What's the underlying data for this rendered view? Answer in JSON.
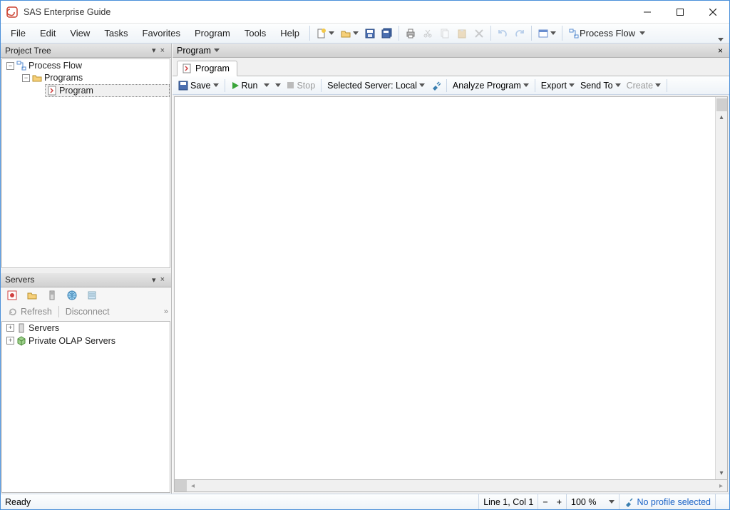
{
  "app": {
    "title": "SAS Enterprise Guide"
  },
  "menu": {
    "file": "File",
    "edit": "Edit",
    "view": "View",
    "tasks": "Tasks",
    "favorites": "Favorites",
    "program": "Program",
    "tools": "Tools",
    "help": "Help",
    "process_flow": "Process Flow"
  },
  "project_tree": {
    "title": "Project Tree",
    "root": "Process Flow",
    "folder": "Programs",
    "item": "Program"
  },
  "servers": {
    "title": "Servers",
    "refresh": "Refresh",
    "disconnect": "Disconnect",
    "node_servers": "Servers",
    "node_olap": "Private OLAP Servers"
  },
  "main": {
    "title": "Program",
    "tab": "Program"
  },
  "editbar": {
    "save": "Save",
    "run": "Run",
    "stop": "Stop",
    "server": "Selected Server: Local",
    "analyze": "Analyze Program",
    "export": "Export",
    "sendto": "Send To",
    "create": "Create"
  },
  "status": {
    "ready": "Ready",
    "pos": "Line 1, Col 1",
    "zoom": "100 %",
    "profile": "No profile selected"
  }
}
